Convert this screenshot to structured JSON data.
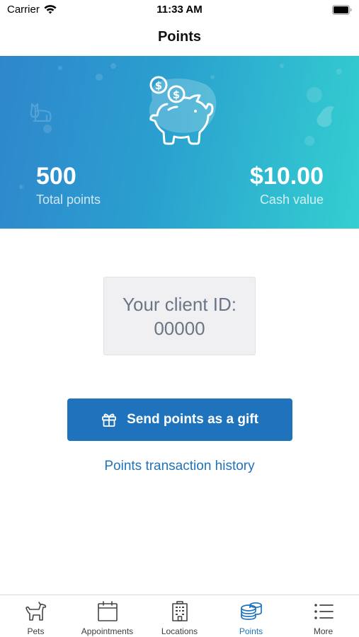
{
  "status_bar": {
    "carrier": "Carrier",
    "time": "11:33 AM"
  },
  "nav": {
    "title": "Points"
  },
  "hero": {
    "total_points_value": "500",
    "total_points_label": "Total points",
    "cash_value": "$10.00",
    "cash_label": "Cash value",
    "icon": "piggy-bank-coins-icon"
  },
  "client_id": {
    "label": "Your client ID:",
    "value": "00000"
  },
  "actions": {
    "gift_button_label": "Send points as a gift",
    "gift_icon": "gift-icon",
    "history_link": "Points transaction history"
  },
  "tab_bar": {
    "active": "Points",
    "items": [
      {
        "label": "Pets",
        "icon": "dog-icon"
      },
      {
        "label": "Appointments",
        "icon": "calendar-icon"
      },
      {
        "label": "Locations",
        "icon": "building-icon"
      },
      {
        "label": "Points",
        "icon": "coins-icon"
      },
      {
        "label": "More",
        "icon": "menu-list-icon"
      }
    ]
  },
  "colors": {
    "accent": "#1f73bd",
    "hero_start": "#2f86cc",
    "hero_end": "#34cfd0"
  }
}
